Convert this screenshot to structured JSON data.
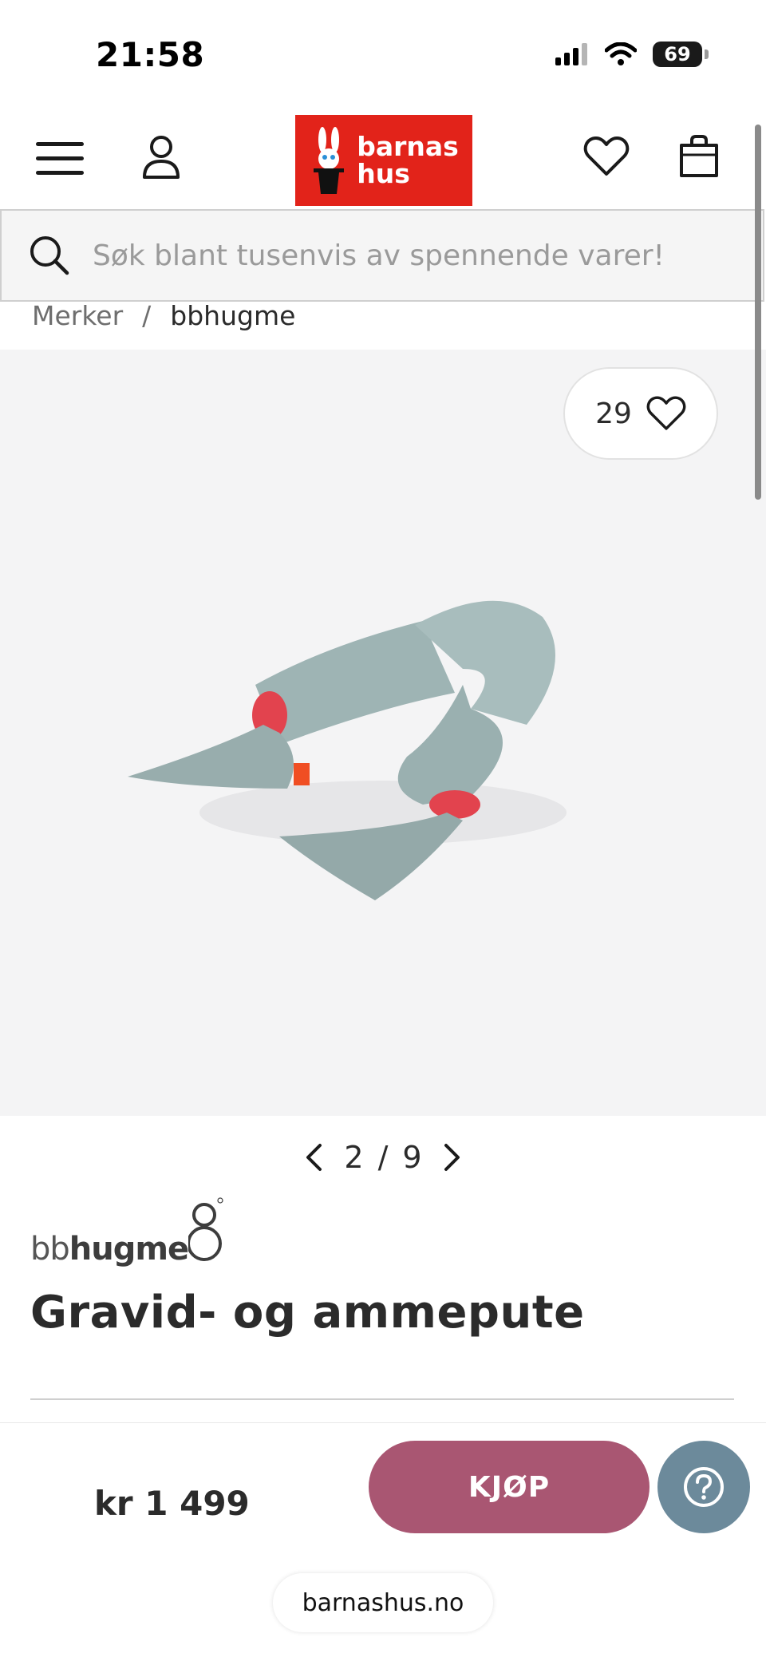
{
  "status_bar": {
    "time": "21:58",
    "battery": "69",
    "icons": [
      "signal-icon",
      "wifi-icon",
      "battery-icon"
    ]
  },
  "header": {
    "menu_icon": "hamburger-menu-icon",
    "account_icon": "user-icon",
    "logo_line1": "barnas",
    "logo_line2": "hus",
    "wishlist_icon": "heart-icon",
    "cart_icon": "shopping-bag-icon",
    "logo_color": "#e2231a"
  },
  "search": {
    "placeholder": "Søk blant tusenvis av spennende varer!"
  },
  "breadcrumb": {
    "items": [
      "Merker",
      "bbhugme"
    ],
    "separator": "/"
  },
  "gallery": {
    "favorite_count": "29",
    "current_page": "2",
    "separator": "/",
    "total_pages": "9"
  },
  "product": {
    "brand_light": "bb",
    "brand_bold": "hugme",
    "title": "Gravid- og ammepute",
    "price": "kr 1 499"
  },
  "actions": {
    "buy_label": "KJØP",
    "buy_color": "#a95672",
    "help_color": "#6c8a9b"
  },
  "browser": {
    "url": "barnashus.no"
  }
}
